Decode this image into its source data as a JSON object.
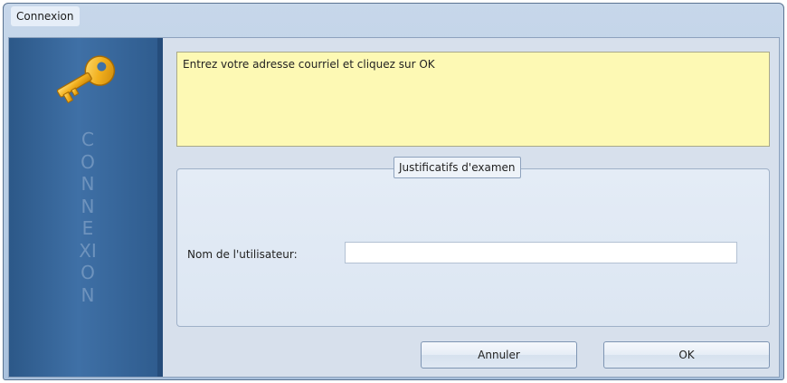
{
  "window": {
    "title": "Connexion"
  },
  "sidebar": {
    "vertical_text": "CONNEXION",
    "icon": "key-icon",
    "colors": {
      "background": "#3a6aa0",
      "text": "#6e93bd",
      "key": "#f2b01e"
    }
  },
  "message": {
    "text": "Entrez votre adresse courriel et cliquez sur OK",
    "background": "#fdf9b4"
  },
  "credentials": {
    "legend": "Justificatifs d'examen",
    "username_label": "Nom de l'utilisateur:",
    "username_value": ""
  },
  "buttons": {
    "cancel": "Annuler",
    "ok": "OK"
  }
}
